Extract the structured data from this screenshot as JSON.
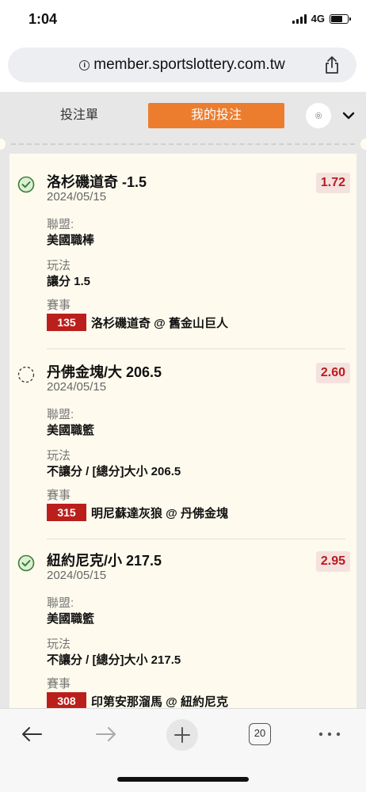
{
  "status_bar": {
    "time": "1:04",
    "network": "4G"
  },
  "browser": {
    "url": "member.sportslottery.com.tw",
    "tabs_count": "20"
  },
  "tabs": {
    "betslip_label": "投注單",
    "mybets_label": "我的投注"
  },
  "field_labels": {
    "league": "聯盟:",
    "market": "玩法",
    "event": "賽事"
  },
  "bets": [
    {
      "status": "settled",
      "title": "洛杉磯道奇 -1.5",
      "date": "2024/05/15",
      "odds": "1.72",
      "league": "美國職棒",
      "market": "讓分 1.5",
      "event_code": "135",
      "event_name": "洛杉磯道奇 @ 舊金山巨人"
    },
    {
      "status": "pending",
      "title": "丹佛金塊/大 206.5",
      "date": "2024/05/15",
      "odds": "2.60",
      "league": "美國職籃",
      "market": "不讓分 / [總分]大小 206.5",
      "event_code": "315",
      "event_name": "明尼蘇達灰狼 @ 丹佛金塊"
    },
    {
      "status": "settled",
      "title": "紐約尼克/小 217.5",
      "date": "2024/05/15",
      "odds": "2.95",
      "league": "美國職籃",
      "market": "不讓分 / [總分]大小 217.5",
      "event_code": "308",
      "event_name": "印第安那溜馬 @ 紐約尼克"
    }
  ],
  "colors": {
    "accent_orange": "#ec7d2f",
    "event_red": "#bb1f1c",
    "odds_red": "#b81d1d",
    "check_green": "#3a7f33",
    "card_bg": "#fefbee"
  },
  "icons": {
    "settled": "check-circle-icon",
    "pending": "dashed-circle-icon",
    "settings": "gear-icon",
    "collapse": "chevron-down-icon"
  }
}
